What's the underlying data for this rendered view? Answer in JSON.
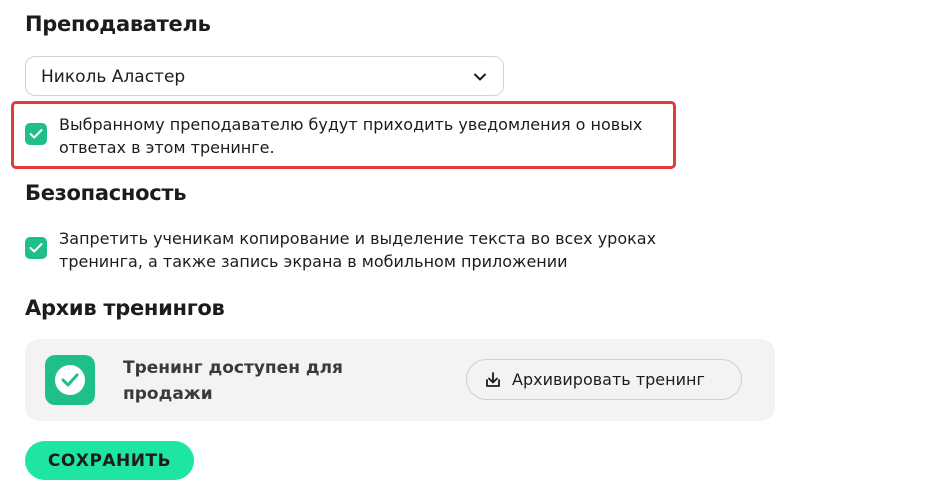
{
  "teacher": {
    "title": "Преподаватель",
    "selected": "Николь Аластер",
    "notify_checked": true,
    "notify_text": "Выбранному преподавателю будут приходить уведомления о новых ответах в этом тренинге."
  },
  "security": {
    "title": "Безопасность",
    "checked": true,
    "text": "Запретить ученикам копирование и выделение текста во всех уроках тренинга, а также запись экрана в мобильном приложении"
  },
  "archive": {
    "title": "Архив тренингов",
    "status_icon": "check-circle-icon",
    "status_text": "Тренинг доступен для продажи",
    "button_icon": "download-icon",
    "button_label": "Архивировать тренинг"
  },
  "save": {
    "label": "СОХРАНИТЬ"
  },
  "colors": {
    "accent": "#1fbf8a",
    "save_button": "#1ee6a0",
    "highlight": "#e03a3a",
    "card_bg": "#f3f3f3"
  }
}
